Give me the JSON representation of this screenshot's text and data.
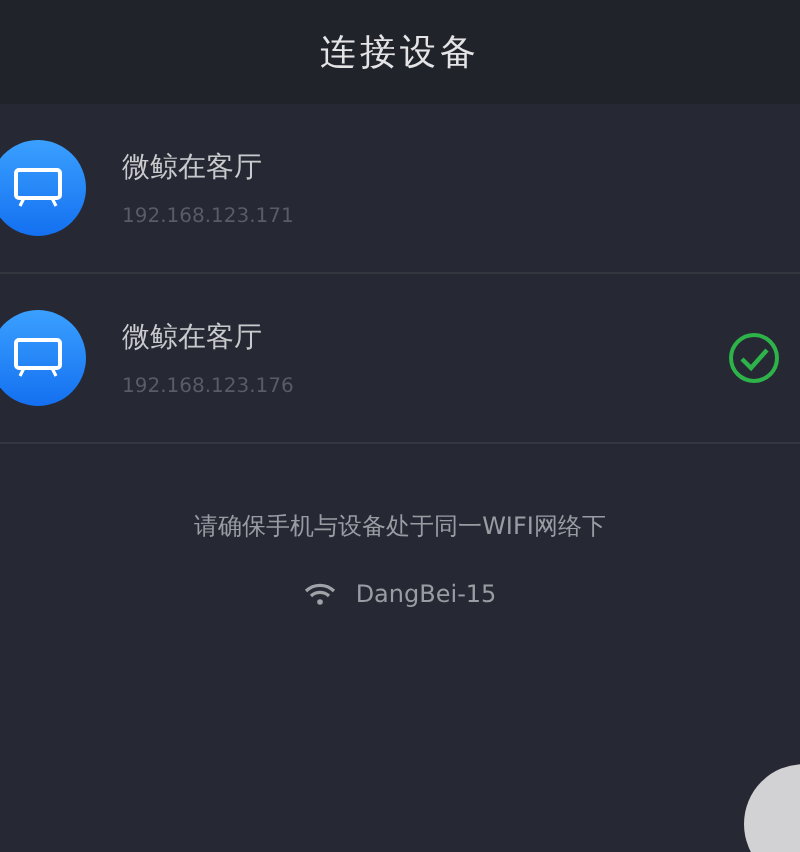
{
  "header": {
    "title": "连接设备"
  },
  "devices": [
    {
      "name": "微鲸在客厅",
      "ip": "192.168.123.171",
      "selected": false
    },
    {
      "name": "微鲸在客厅",
      "ip": "192.168.123.176",
      "selected": true
    }
  ],
  "notice": "请确保手机与设备处于同一WIFI网络下",
  "network": {
    "ssid": "DangBei-15"
  }
}
